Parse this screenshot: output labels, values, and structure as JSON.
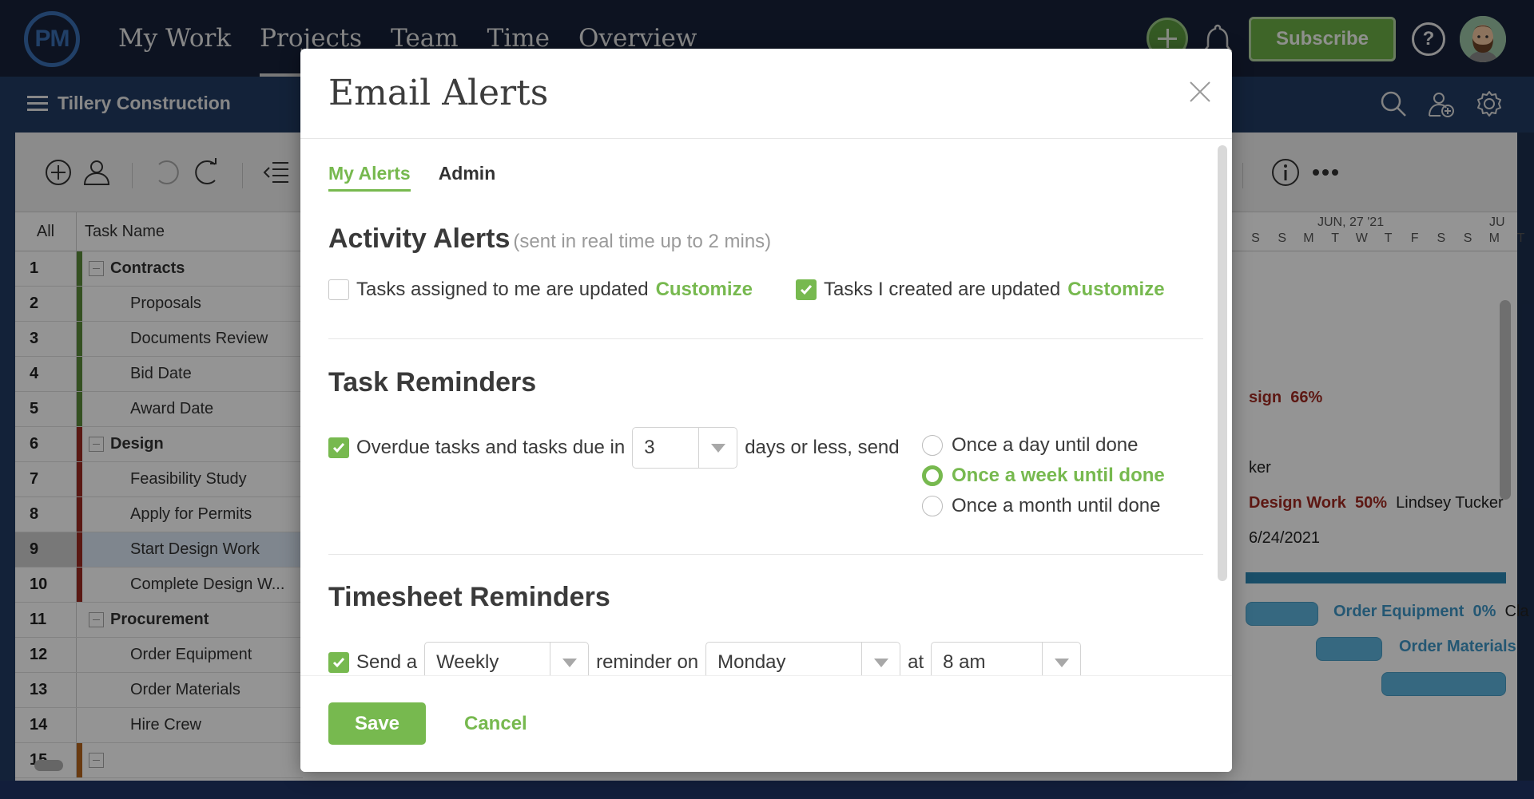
{
  "topnav": {
    "logo": "PM",
    "links": [
      "My Work",
      "Projects",
      "Team",
      "Time",
      "Overview"
    ],
    "active_link": "Projects",
    "subscribe_label": "Subscribe",
    "help_label": "?"
  },
  "subbar": {
    "project_title": "Tillery Construction"
  },
  "grid": {
    "header_all": "All",
    "header_task_name": "Task Name",
    "rows": [
      {
        "num": "1",
        "name": "Contracts",
        "group": true,
        "color": "#5a8a3a"
      },
      {
        "num": "2",
        "name": "Proposals",
        "group": false,
        "color": "#5a8a3a"
      },
      {
        "num": "3",
        "name": "Documents Review",
        "group": false,
        "color": "#5a8a3a"
      },
      {
        "num": "4",
        "name": "Bid Date",
        "group": false,
        "color": "#5a8a3a"
      },
      {
        "num": "5",
        "name": "Award Date",
        "group": false,
        "color": "#5a8a3a"
      },
      {
        "num": "6",
        "name": "Design",
        "group": true,
        "color": "#9b2a22"
      },
      {
        "num": "7",
        "name": "Feasibility Study",
        "group": false,
        "color": "#9b2a22"
      },
      {
        "num": "8",
        "name": "Apply for Permits",
        "group": false,
        "color": "#9b2a22"
      },
      {
        "num": "9",
        "name": "Start Design Work",
        "group": false,
        "color": "#9b2a22",
        "selected": true
      },
      {
        "num": "10",
        "name": "Complete Design W...",
        "group": false,
        "color": "#9b2a22"
      },
      {
        "num": "11",
        "name": "Procurement",
        "group": true,
        "color": ""
      },
      {
        "num": "12",
        "name": "Order Equipment",
        "group": false,
        "color": ""
      },
      {
        "num": "13",
        "name": "Order Materials",
        "group": false,
        "color": ""
      },
      {
        "num": "14",
        "name": "Hire Crew",
        "group": false,
        "color": ""
      },
      {
        "num": "15",
        "name": "",
        "group": true,
        "color": "#b5651d"
      }
    ]
  },
  "gantt": {
    "week_label": "JUN, 27 '21",
    "week_label_next": "JU",
    "days": [
      "S",
      "S",
      "M",
      "T",
      "W",
      "T",
      "F",
      "S",
      "S",
      "M",
      "T"
    ],
    "labels": {
      "design": "sign",
      "design_pct": "66%",
      "row8_assignee": "ker",
      "start_design": "Design Work",
      "start_design_pct": "50%",
      "start_design_assignee": "Lindsey Tucker",
      "row10_date": "6/24/2021",
      "order_equipment": "Order Equipment",
      "order_equipment_pct": "0%",
      "order_equipment_assignee": "Cla",
      "order_materials": "Order Materials"
    }
  },
  "modal": {
    "title": "Email Alerts",
    "tabs": [
      {
        "label": "My Alerts",
        "active": true
      },
      {
        "label": "Admin",
        "active": false
      }
    ],
    "activity": {
      "title": "Activity Alerts",
      "subtitle": "(sent in real time up to 2 mins)",
      "option1": {
        "label": "Tasks assigned to me are updated",
        "checked": false,
        "link": "Customize"
      },
      "option2": {
        "label": "Tasks I created are updated",
        "checked": true,
        "link": "Customize"
      }
    },
    "task_reminders": {
      "title": "Task Reminders",
      "checked": true,
      "prefix": "Overdue tasks and tasks due in",
      "days_value": "3",
      "suffix": "days or less, send",
      "frequency_options": [
        {
          "label": "Once a day until done",
          "checked": false
        },
        {
          "label": "Once a week until done",
          "checked": true
        },
        {
          "label": "Once a month until done",
          "checked": false
        }
      ]
    },
    "timesheet": {
      "title": "Timesheet Reminders",
      "checked": true,
      "send_a": "Send a",
      "frequency": "Weekly",
      "reminder_on": "reminder on",
      "day": "Monday",
      "at": "at",
      "time": "8 am"
    },
    "save_label": "Save",
    "cancel_label": "Cancel"
  }
}
